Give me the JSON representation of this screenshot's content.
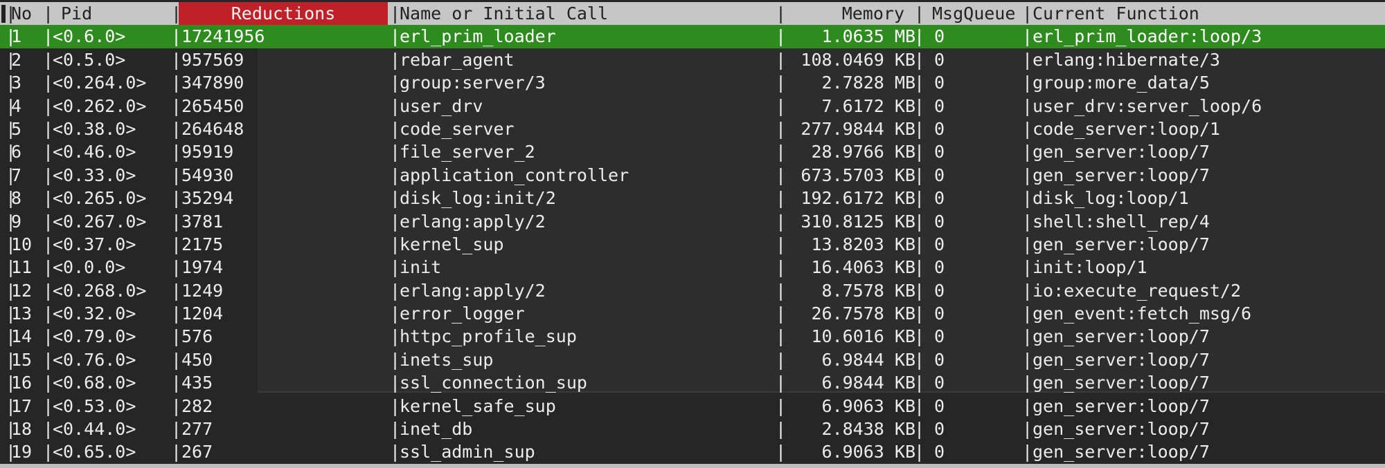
{
  "columns": {
    "no": "No",
    "pid": "Pid",
    "reductions": "Reductions",
    "name": "Name or Initial Call",
    "memory": "Memory",
    "msgqueue": "MsgQueue",
    "current_function": "Current Function"
  },
  "colors": {
    "header_bg": "#c6c6c6",
    "sort_column_bg": "#c02128",
    "selected_row_bg": "#2e8b1e",
    "terminal_bg": "#262626"
  },
  "rows": [
    {
      "no": "1",
      "pid": "<0.6.0>",
      "reductions": "17241956",
      "name": "erl_prim_loader",
      "memory": "1.0635 MB",
      "msgqueue": "0",
      "current_function": "erl_prim_loader:loop/3"
    },
    {
      "no": "2",
      "pid": "<0.5.0>",
      "reductions": "957569",
      "name": "rebar_agent",
      "memory": "108.0469 KB",
      "msgqueue": "0",
      "current_function": "erlang:hibernate/3"
    },
    {
      "no": "3",
      "pid": "<0.264.0>",
      "reductions": "347890",
      "name": "group:server/3",
      "memory": "2.7828 MB",
      "msgqueue": "0",
      "current_function": "group:more_data/5"
    },
    {
      "no": "4",
      "pid": "<0.262.0>",
      "reductions": "265450",
      "name": "user_drv",
      "memory": "7.6172 KB",
      "msgqueue": "0",
      "current_function": "user_drv:server_loop/6"
    },
    {
      "no": "5",
      "pid": "<0.38.0>",
      "reductions": "264648",
      "name": "code_server",
      "memory": "277.9844 KB",
      "msgqueue": "0",
      "current_function": "code_server:loop/1"
    },
    {
      "no": "6",
      "pid": "<0.46.0>",
      "reductions": "95919",
      "name": "file_server_2",
      "memory": "28.9766 KB",
      "msgqueue": "0",
      "current_function": "gen_server:loop/7"
    },
    {
      "no": "7",
      "pid": "<0.33.0>",
      "reductions": "54930",
      "name": "application_controller",
      "memory": "673.5703 KB",
      "msgqueue": "0",
      "current_function": "gen_server:loop/7"
    },
    {
      "no": "8",
      "pid": "<0.265.0>",
      "reductions": "35294",
      "name": "disk_log:init/2",
      "memory": "192.6172 KB",
      "msgqueue": "0",
      "current_function": "disk_log:loop/1"
    },
    {
      "no": "9",
      "pid": "<0.267.0>",
      "reductions": "3781",
      "name": "erlang:apply/2",
      "memory": "310.8125 KB",
      "msgqueue": "0",
      "current_function": "shell:shell_rep/4"
    },
    {
      "no": "10",
      "pid": "<0.37.0>",
      "reductions": "2175",
      "name": "kernel_sup",
      "memory": "13.8203 KB",
      "msgqueue": "0",
      "current_function": "gen_server:loop/7"
    },
    {
      "no": "11",
      "pid": "<0.0.0>",
      "reductions": "1974",
      "name": "init",
      "memory": "16.4063 KB",
      "msgqueue": "0",
      "current_function": "init:loop/1"
    },
    {
      "no": "12",
      "pid": "<0.268.0>",
      "reductions": "1249",
      "name": "erlang:apply/2",
      "memory": "8.7578 KB",
      "msgqueue": "0",
      "current_function": "io:execute_request/2"
    },
    {
      "no": "13",
      "pid": "<0.32.0>",
      "reductions": "1204",
      "name": "error_logger",
      "memory": "26.7578 KB",
      "msgqueue": "0",
      "current_function": "gen_event:fetch_msg/6"
    },
    {
      "no": "14",
      "pid": "<0.79.0>",
      "reductions": "576",
      "name": "httpc_profile_sup",
      "memory": "10.6016 KB",
      "msgqueue": "0",
      "current_function": "gen_server:loop/7"
    },
    {
      "no": "15",
      "pid": "<0.76.0>",
      "reductions": "450",
      "name": "inets_sup",
      "memory": "6.9844 KB",
      "msgqueue": "0",
      "current_function": "gen_server:loop/7"
    },
    {
      "no": "16",
      "pid": "<0.68.0>",
      "reductions": "435",
      "name": "ssl_connection_sup",
      "memory": "6.9844 KB",
      "msgqueue": "0",
      "current_function": "gen_server:loop/7"
    },
    {
      "no": "17",
      "pid": "<0.53.0>",
      "reductions": "282",
      "name": "kernel_safe_sup",
      "memory": "6.9063 KB",
      "msgqueue": "0",
      "current_function": "gen_server:loop/7"
    },
    {
      "no": "18",
      "pid": "<0.44.0>",
      "reductions": "277",
      "name": "inet_db",
      "memory": "2.8438 KB",
      "msgqueue": "0",
      "current_function": "gen_server:loop/7"
    },
    {
      "no": "19",
      "pid": "<0.65.0>",
      "reductions": "267",
      "name": "ssl_admin_sup",
      "memory": "6.9063 KB",
      "msgqueue": "0",
      "current_function": "gen_server:loop/7"
    }
  ]
}
